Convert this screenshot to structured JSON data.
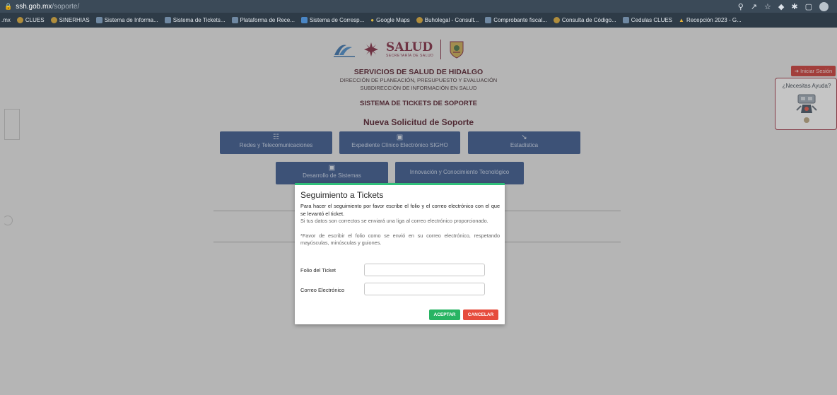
{
  "browser": {
    "url_host": "ssh.gob.mx",
    "url_path": "/soporte/",
    "bookmarks": [
      {
        "label": ".mx",
        "icon": "none"
      },
      {
        "label": "CLUES",
        "icon": "circle"
      },
      {
        "label": "SINERHIAS",
        "icon": "circle"
      },
      {
        "label": "Sistema de Informa...",
        "icon": "favicon"
      },
      {
        "label": "Sistema de Tickets...",
        "icon": "favicon"
      },
      {
        "label": "Plataforma de Rece...",
        "icon": "favicon"
      },
      {
        "label": "Sistema de Corresp...",
        "icon": "grid"
      },
      {
        "label": "Google Maps",
        "icon": "pin"
      },
      {
        "label": "Buholegal - Consult...",
        "icon": "owl"
      },
      {
        "label": "Comprobante fiscal...",
        "icon": "favicon"
      },
      {
        "label": "Consulta de Código...",
        "icon": "circle"
      },
      {
        "label": "Cedulas CLUES",
        "icon": "favicon"
      },
      {
        "label": "Recepción 2023 - G...",
        "icon": "drive"
      }
    ]
  },
  "header": {
    "brand": "SALUD",
    "brand_sub": "SECRETARÍA DE SALUD",
    "org": "SERVICIOS DE SALUD DE HIDALGO",
    "direction": "DIRECCIÓN DE PLANEACIÓN, PRESUPUESTO Y EVALUACIÓN",
    "subdirection": "SUBDIRECCIÓN DE INFORMACIÓN EN SALUD",
    "system": "SISTEMA DE TICKETS DE SOPORTE",
    "heading": "Nueva Solicitud de Soporte"
  },
  "categories": [
    {
      "label": "Redes y Telecomunicaciones",
      "icon": "network-icon"
    },
    {
      "label": "Expediente Clínico Electrónico SIGHO",
      "icon": "monitor-icon"
    },
    {
      "label": "Estadística",
      "icon": "chart-icon"
    },
    {
      "label": "Desarrollo de Sistemas",
      "icon": "laptop-icon"
    },
    {
      "label": "Innovación y Conocimiento Tecnológico",
      "icon": ""
    }
  ],
  "topright": {
    "login_label": "Iniciar Sesión",
    "help_label": "¿Necesitas Ayuda?"
  },
  "modal": {
    "title": "Seguimiento a Tickets",
    "p1": "Para hacer el seguimiento por favor escribe el folio y el correo electrónico con el que se levantó el ticket.",
    "p2": "Si tus datos son correctos se enviará una liga al correo electrónico proporcionado.",
    "p3": "*Favor de escribir el folio como se envió en su correo electrónico, respetando mayúsculas, minúsculas y guiones.",
    "folio_label": "Folio del Ticket",
    "folio_value": "",
    "email_label": "Correo Electrónico",
    "email_value": "",
    "accept_label": "ACEPTAR",
    "cancel_label": "CANCELAR"
  },
  "colors": {
    "accent_green": "#28b463",
    "danger_red": "#e64c3c",
    "brand_maroon": "#7a1f38",
    "category_blue": "#2f4f88"
  }
}
